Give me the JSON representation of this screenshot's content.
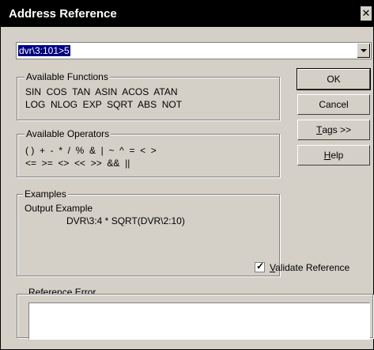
{
  "window": {
    "title": "Address Reference",
    "close_glyph": "✕"
  },
  "address": {
    "value": "dvr\\3:101>5"
  },
  "functions": {
    "label": "Available Functions",
    "line1": "SIN  COS  TAN  ASIN  ACOS  ATAN",
    "line2": "LOG  NLOG  EXP  SQRT  ABS  NOT"
  },
  "operators": {
    "label": "Available Operators",
    "line1": "( )  +  -  *  /  %  &  |  ~  ^  =  <  >",
    "line2": "<=  >=  <>  <<  >>  &&  ||"
  },
  "examples": {
    "label": "Examples",
    "line1": "Output Example",
    "line2": "DVR\\3:4 * SQRT(DVR\\2:10)"
  },
  "buttons": {
    "ok": "OK",
    "cancel": "Cancel",
    "tags_key": "T",
    "tags_rest": "ags >>",
    "help_key": "H",
    "help_rest": "elp"
  },
  "validate": {
    "key": "V",
    "rest": "alidate Reference",
    "checked": true,
    "check_glyph": "✓"
  },
  "error": {
    "label": "Reference Error",
    "value": ""
  }
}
